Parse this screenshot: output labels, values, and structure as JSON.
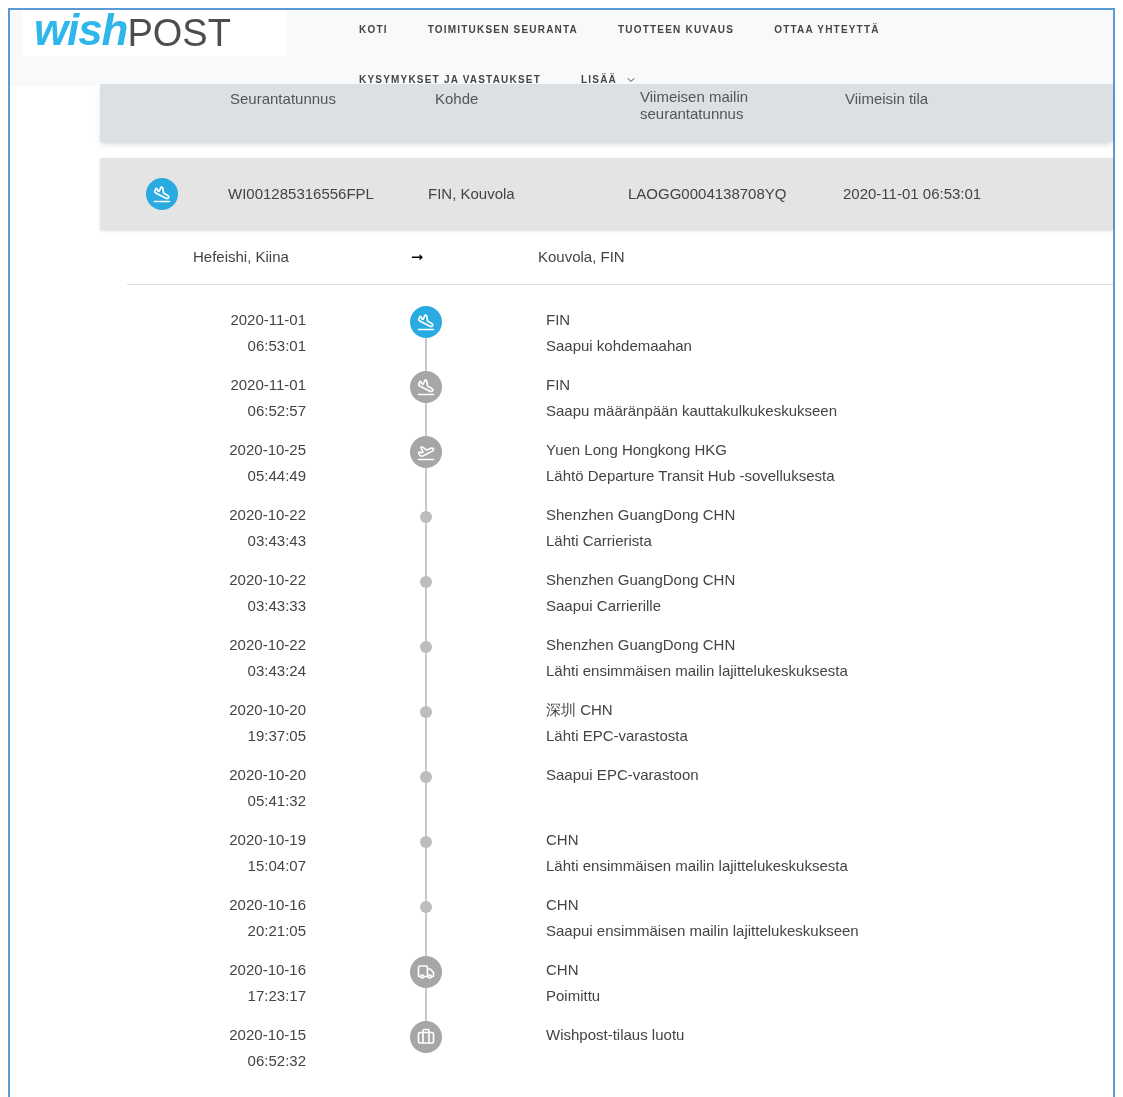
{
  "logo": {
    "part_1": "wish",
    "part_2": "POST"
  },
  "nav": [
    {
      "label": "KOTI",
      "dropdown": false
    },
    {
      "label": "TOIMITUKSEN SEURANTA",
      "dropdown": false
    },
    {
      "label": "TUOTTEEN KUVAUS",
      "dropdown": false
    },
    {
      "label": "OTTAA YHTEYTTÄ",
      "dropdown": false
    },
    {
      "label": "KYSYMYKSET JA VASTAUKSET",
      "dropdown": false
    },
    {
      "label": "LISÄÄ",
      "dropdown": true
    }
  ],
  "table": {
    "columns": [
      "Seurantatunnus",
      "Kohde",
      "Viimeisen mailin seurantatunnus",
      "Viimeisin tila"
    ],
    "row": {
      "cells": [
        "WI001285316556FPL",
        "FIN, Kouvola",
        "LAOGG0004138708YQ",
        "2020-11-01 06:53:01"
      ]
    }
  },
  "route": {
    "origin": "Hefeishi, Kiina",
    "arrow": "➞",
    "destination": "Kouvola, FIN"
  },
  "events": [
    {
      "date": "2020-11-01",
      "time": "06:53:01",
      "kind": "arrival",
      "active": true,
      "location": "FIN",
      "status": "Saapui kohdemaahan"
    },
    {
      "date": "2020-11-01",
      "time": "06:52:57",
      "kind": "arrival",
      "active": false,
      "location": "FIN",
      "status": "Saapu määränpään kauttakulkukeskukseen"
    },
    {
      "date": "2020-10-25",
      "time": "05:44:49",
      "kind": "departure",
      "active": false,
      "location": "Yuen Long Hongkong HKG",
      "status": "Lähtö Departure Transit Hub -sovelluksesta"
    },
    {
      "date": "2020-10-22",
      "time": "03:43:43",
      "kind": "dot",
      "active": false,
      "location": "Shenzhen GuangDong CHN",
      "status": "Lähti Carrierista"
    },
    {
      "date": "2020-10-22",
      "time": "03:43:33",
      "kind": "dot",
      "active": false,
      "location": "Shenzhen GuangDong CHN",
      "status": "Saapui Carrierille"
    },
    {
      "date": "2020-10-22",
      "time": "03:43:24",
      "kind": "dot",
      "active": false,
      "location": "Shenzhen GuangDong CHN",
      "status": "Lähti ensimmäisen mailin lajittelukeskuksesta"
    },
    {
      "date": "2020-10-20",
      "time": "19:37:05",
      "kind": "dot",
      "active": false,
      "location": "深圳 CHN",
      "status": "Lähti EPC-varastosta"
    },
    {
      "date": "2020-10-20",
      "time": "05:41:32",
      "kind": "dot",
      "active": false,
      "status": "Saapui EPC-varastoon"
    },
    {
      "date": "2020-10-19",
      "time": "15:04:07",
      "kind": "dot",
      "active": false,
      "location": "CHN",
      "status": "Lähti ensimmäisen mailin lajittelukeskuksesta"
    },
    {
      "date": "2020-10-16",
      "time": "20:21:05",
      "kind": "dot",
      "active": false,
      "location": "CHN",
      "status": "Saapui ensimmäisen mailin lajittelukeskukseen"
    },
    {
      "date": "2020-10-16",
      "time": "17:23:17",
      "kind": "truck",
      "active": false,
      "location": "CHN",
      "status": "Poimittu"
    },
    {
      "date": "2020-10-15",
      "time": "06:52:32",
      "kind": "parcel",
      "active": false,
      "status": "Wishpost-tilaus luotu"
    }
  ]
}
